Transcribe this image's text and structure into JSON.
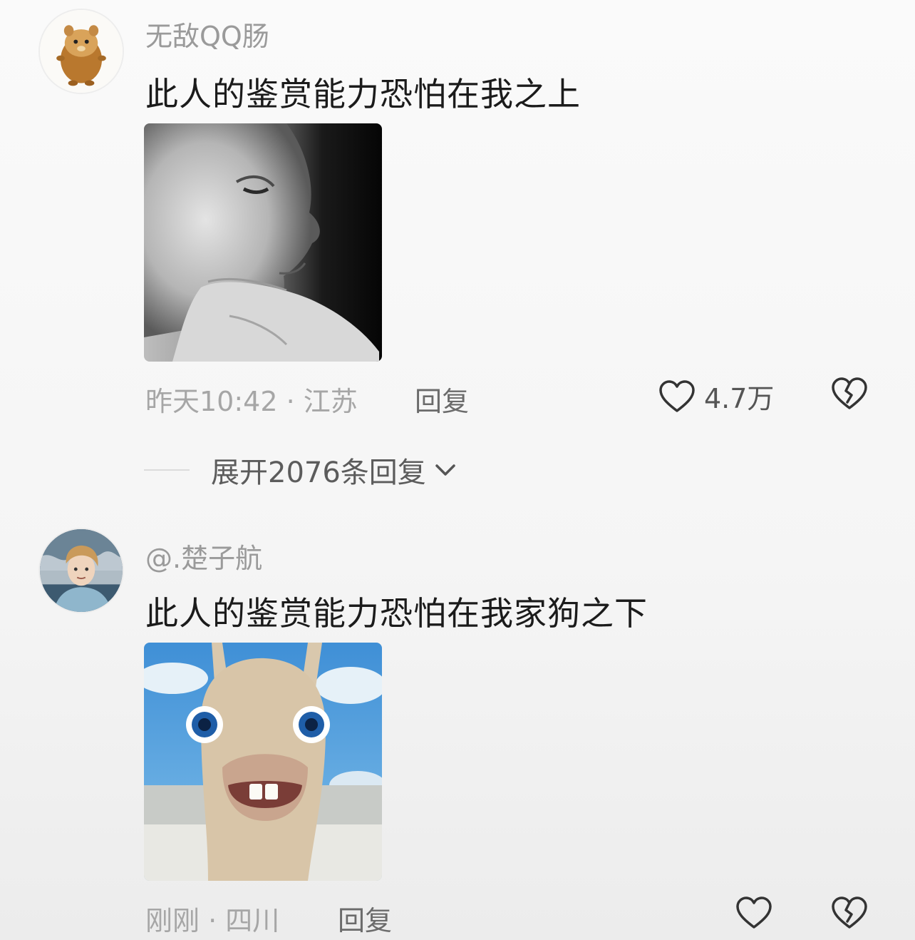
{
  "comments": [
    {
      "username": "无敌QQ肠",
      "text": "此人的鉴赏能力恐怕在我之上",
      "meta": "昨天10:42 · 江苏",
      "reply_label": "回复",
      "like_count": "4.7万",
      "expand_label": "展开2076条回复"
    },
    {
      "username": "@.楚子航",
      "text": "此人的鉴赏能力恐怕在我家狗之下",
      "meta": "刚刚 · 四川",
      "reply_label": "回复",
      "like_count": ""
    }
  ],
  "icons": {
    "like": "heart-outline-icon",
    "dislike": "broken-heart-icon",
    "expand": "chevron-down-icon"
  },
  "colors": {
    "text_primary": "#1b1b1b",
    "text_secondary": "#9a9a9a",
    "reply": "#6b6b6b"
  }
}
